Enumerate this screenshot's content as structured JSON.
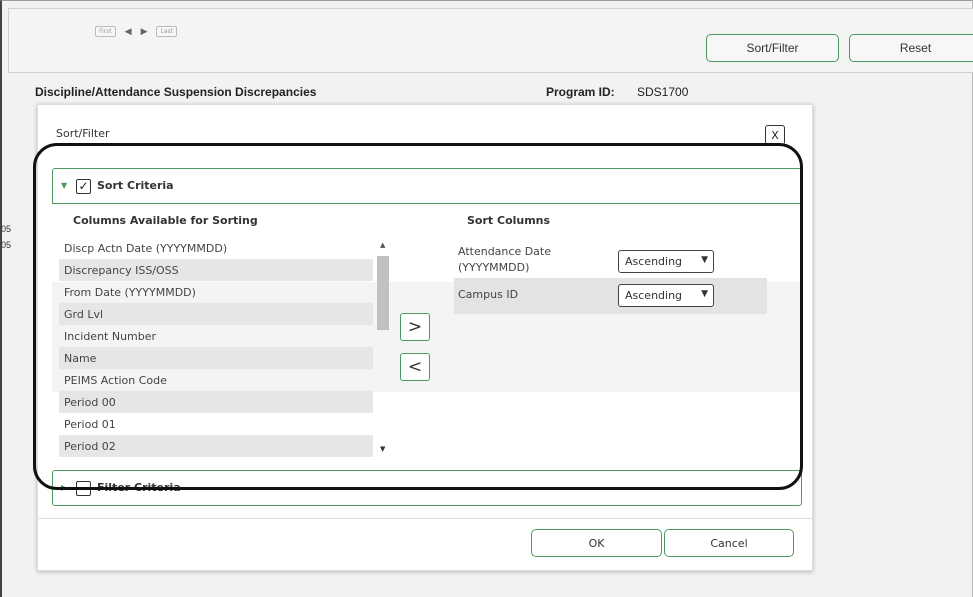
{
  "pager": {
    "first_label": "First",
    "last_label": "Last",
    "prev_icon": "triangle-left-icon",
    "next_icon": "triangle-right-icon"
  },
  "toolbar": {
    "sort_filter_label": "Sort/Filter",
    "reset_label": "Reset"
  },
  "page": {
    "title": "Discipline/Attendance Suspension Discrepancies",
    "program_id_label": "Program ID:",
    "program_id_value": "SDS1700"
  },
  "background_fragments": [
    "05",
    "05"
  ],
  "modal": {
    "title": "Sort/Filter",
    "close_label": "X",
    "sort_section": {
      "label": "Sort Criteria",
      "checked_glyph": "✓",
      "available_header": "Columns Available for Sorting",
      "sort_header": "Sort Columns",
      "available_columns": [
        "Discp Actn Date (YYYYMMDD)",
        "Discrepancy ISS/OSS",
        "From Date (YYYYMMDD)",
        "Grd Lvl",
        "Incident Number",
        "Name",
        "PEIMS Action Code",
        "Period 00",
        "Period 01",
        "Period 02"
      ],
      "move_right_label": ">",
      "move_left_label": "<",
      "sort_columns": [
        {
          "name": "Attendance Date (YYYYMMDD)",
          "order": "Ascending"
        },
        {
          "name": "Campus ID",
          "order": "Ascending"
        }
      ]
    },
    "filter_section": {
      "label": "Filter Criteria"
    },
    "ok_label": "OK",
    "cancel_label": "Cancel"
  },
  "colors": {
    "accent_green": "#4a9a5f",
    "row_shade": "#e6e6e6",
    "annotation_ring": "#111111"
  }
}
